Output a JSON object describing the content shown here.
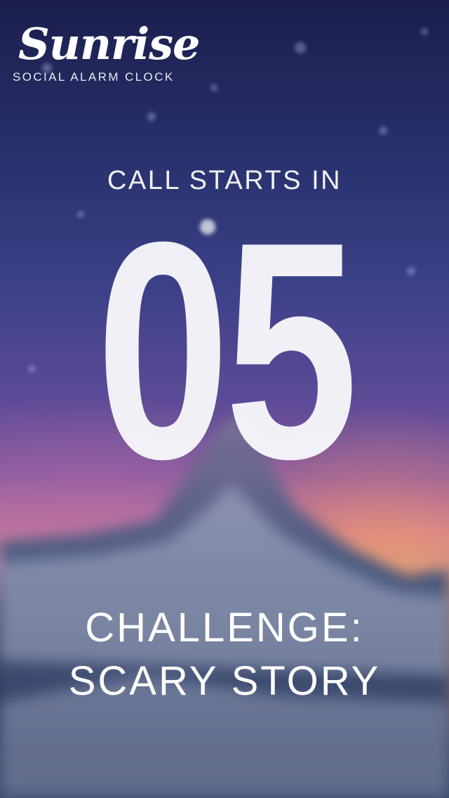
{
  "app": {
    "name": "Sunrise",
    "tagline": "SOCIAL ALARM CLOCK"
  },
  "call": {
    "label": "CALL STARTS IN",
    "countdown": "05"
  },
  "challenge": {
    "line1": "CHALLENGE:",
    "line2": "SCARY STORY"
  },
  "colors": {
    "text": "#f4f4f6",
    "sky_top": "#1b1e4c",
    "horizon_glow": "#ffaa5a"
  }
}
